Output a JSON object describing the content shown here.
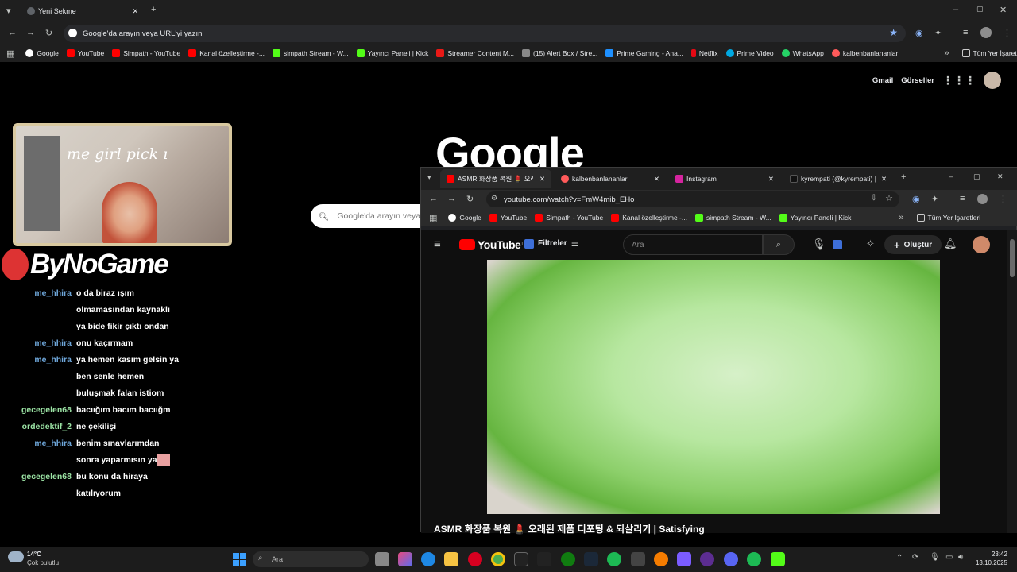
{
  "main_browser": {
    "tab_title": "Yeni Sekme",
    "omnibox_placeholder": "Google'da arayın veya URL'yi yazın",
    "bookmarks": [
      "Google",
      "YouTube",
      "Simpath - YouTube",
      "Kanal özelleştirme -...",
      "simpath Stream - W...",
      "Yayıncı Paneli | Kick",
      "Streamer Content M...",
      "(15) Alert Box / Stre...",
      "Prime Gaming - Ana...",
      "Netflix",
      "Prime Video",
      "WhatsApp",
      "kalbenbanlananlar"
    ],
    "all_bookmarks": "Tüm Yer İşaretleri"
  },
  "google": {
    "gmail": "Gmail",
    "images": "Görseller",
    "logo": "Google",
    "search_placeholder": "Google'da arayın veya"
  },
  "stream": {
    "cam_text": "me girl pick ı",
    "brand": "ByNoGame",
    "chat": [
      {
        "user": "me_hhira",
        "color": "#6fa8dc",
        "text": "o da biraz ışım"
      },
      {
        "user": "",
        "color": "#6fa8dc",
        "text": "olmamasından kaynaklı"
      },
      {
        "user": "",
        "color": "#6fa8dc",
        "text": "ya bide fikir çıktı ondan"
      },
      {
        "user": "me_hhira",
        "color": "#6fa8dc",
        "text": "onu kaçırmam"
      },
      {
        "user": "me_hhira",
        "color": "#6fa8dc",
        "text": "ya hemen kasım gelsin ya"
      },
      {
        "user": "",
        "color": "#6fa8dc",
        "text": "ben senle hemen"
      },
      {
        "user": "",
        "color": "#6fa8dc",
        "text": "buluşmak falan istiom"
      },
      {
        "user": "gecegelen68",
        "color": "#9be3a4",
        "text": "bacıığım bacım bacıığm"
      },
      {
        "user": "ordedektif_2",
        "color": "#9be3a4",
        "text": "ne çekilişi"
      },
      {
        "user": "me_hhira",
        "color": "#6fa8dc",
        "text": "benim sınavlarımdan"
      },
      {
        "user": "",
        "color": "#6fa8dc",
        "text": "sonra yaparmısın ya"
      },
      {
        "user": "gecegelen68",
        "color": "#9be3a4",
        "text": "bu konu da hiraya"
      },
      {
        "user": "",
        "color": "#9be3a4",
        "text": "katılıyorum"
      }
    ]
  },
  "overlay_browser": {
    "tabs": [
      "ASMR 화장품 복원 💄 오래",
      "kalbenbanlananlar",
      "Instagram",
      "kyrempati (@kyrempati) | T"
    ],
    "url": "youtube.com/watch?v=FmW4mib_EHo",
    "bookmarks": [
      "Google",
      "YouTube",
      "Simpath - YouTube",
      "Kanal özelleştirme -...",
      "simpath Stream - W...",
      "Yayıncı Paneli | Kick"
    ],
    "all_bookmarks": "Tüm Yer İşaretleri"
  },
  "youtube": {
    "logo": "YouTube",
    "logo_sup": "TR",
    "filters": "Filtreler",
    "search_placeholder": "Ara",
    "create": "Oluştur",
    "video_title": "ASMR 화장품 복원 💄 오래된 제품 디포팅 & 되살리기 | Satisfying"
  },
  "taskbar": {
    "weather_temp": "14°C",
    "weather_desc": "Çok bulutlu",
    "search_placeholder": "Ara",
    "time": "23:42",
    "date": "13.10.2025"
  }
}
